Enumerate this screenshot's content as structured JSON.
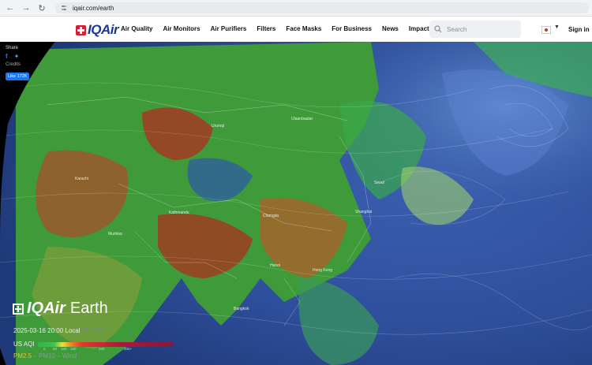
{
  "browser": {
    "url": "iqair.com/earth"
  },
  "header": {
    "brand": "IQAir",
    "nav": [
      "Air Quality",
      "Air Monitors",
      "Air Purifiers",
      "Filters",
      "Face Masks",
      "For Business",
      "News",
      "Impact"
    ],
    "search_placeholder": "Search",
    "sign_in": "Sign in"
  },
  "share_panel": {
    "title": "Share",
    "credits": "Credits",
    "like_label": "Like 172K"
  },
  "map_labels": [
    "Urumqi",
    "Chengdu",
    "Mumbai",
    "Kathmandu",
    "Karachi",
    "Seoul",
    "Hong Kong",
    "Shanghai",
    "Ulaanbaatar",
    "Bangkok",
    "Hanoi"
  ],
  "overlay": {
    "brand": "IQAir",
    "product": "Earth",
    "datetime": "2025-03-16 20:00 Local",
    "utc": "11 UTC",
    "aqi_label": "US AQI",
    "scale_ticks": [
      "0",
      "50",
      "100",
      "150",
      "200",
      "300+"
    ],
    "pm25": "PM2.5",
    "dash": "–",
    "pm10": "PM10",
    "wind": "Wind"
  },
  "colors": {
    "brand_blue": "#1a3a8f",
    "brand_red": "#d9202c",
    "facebook": "#1877f2",
    "pm25_active": "#e0c43a"
  }
}
